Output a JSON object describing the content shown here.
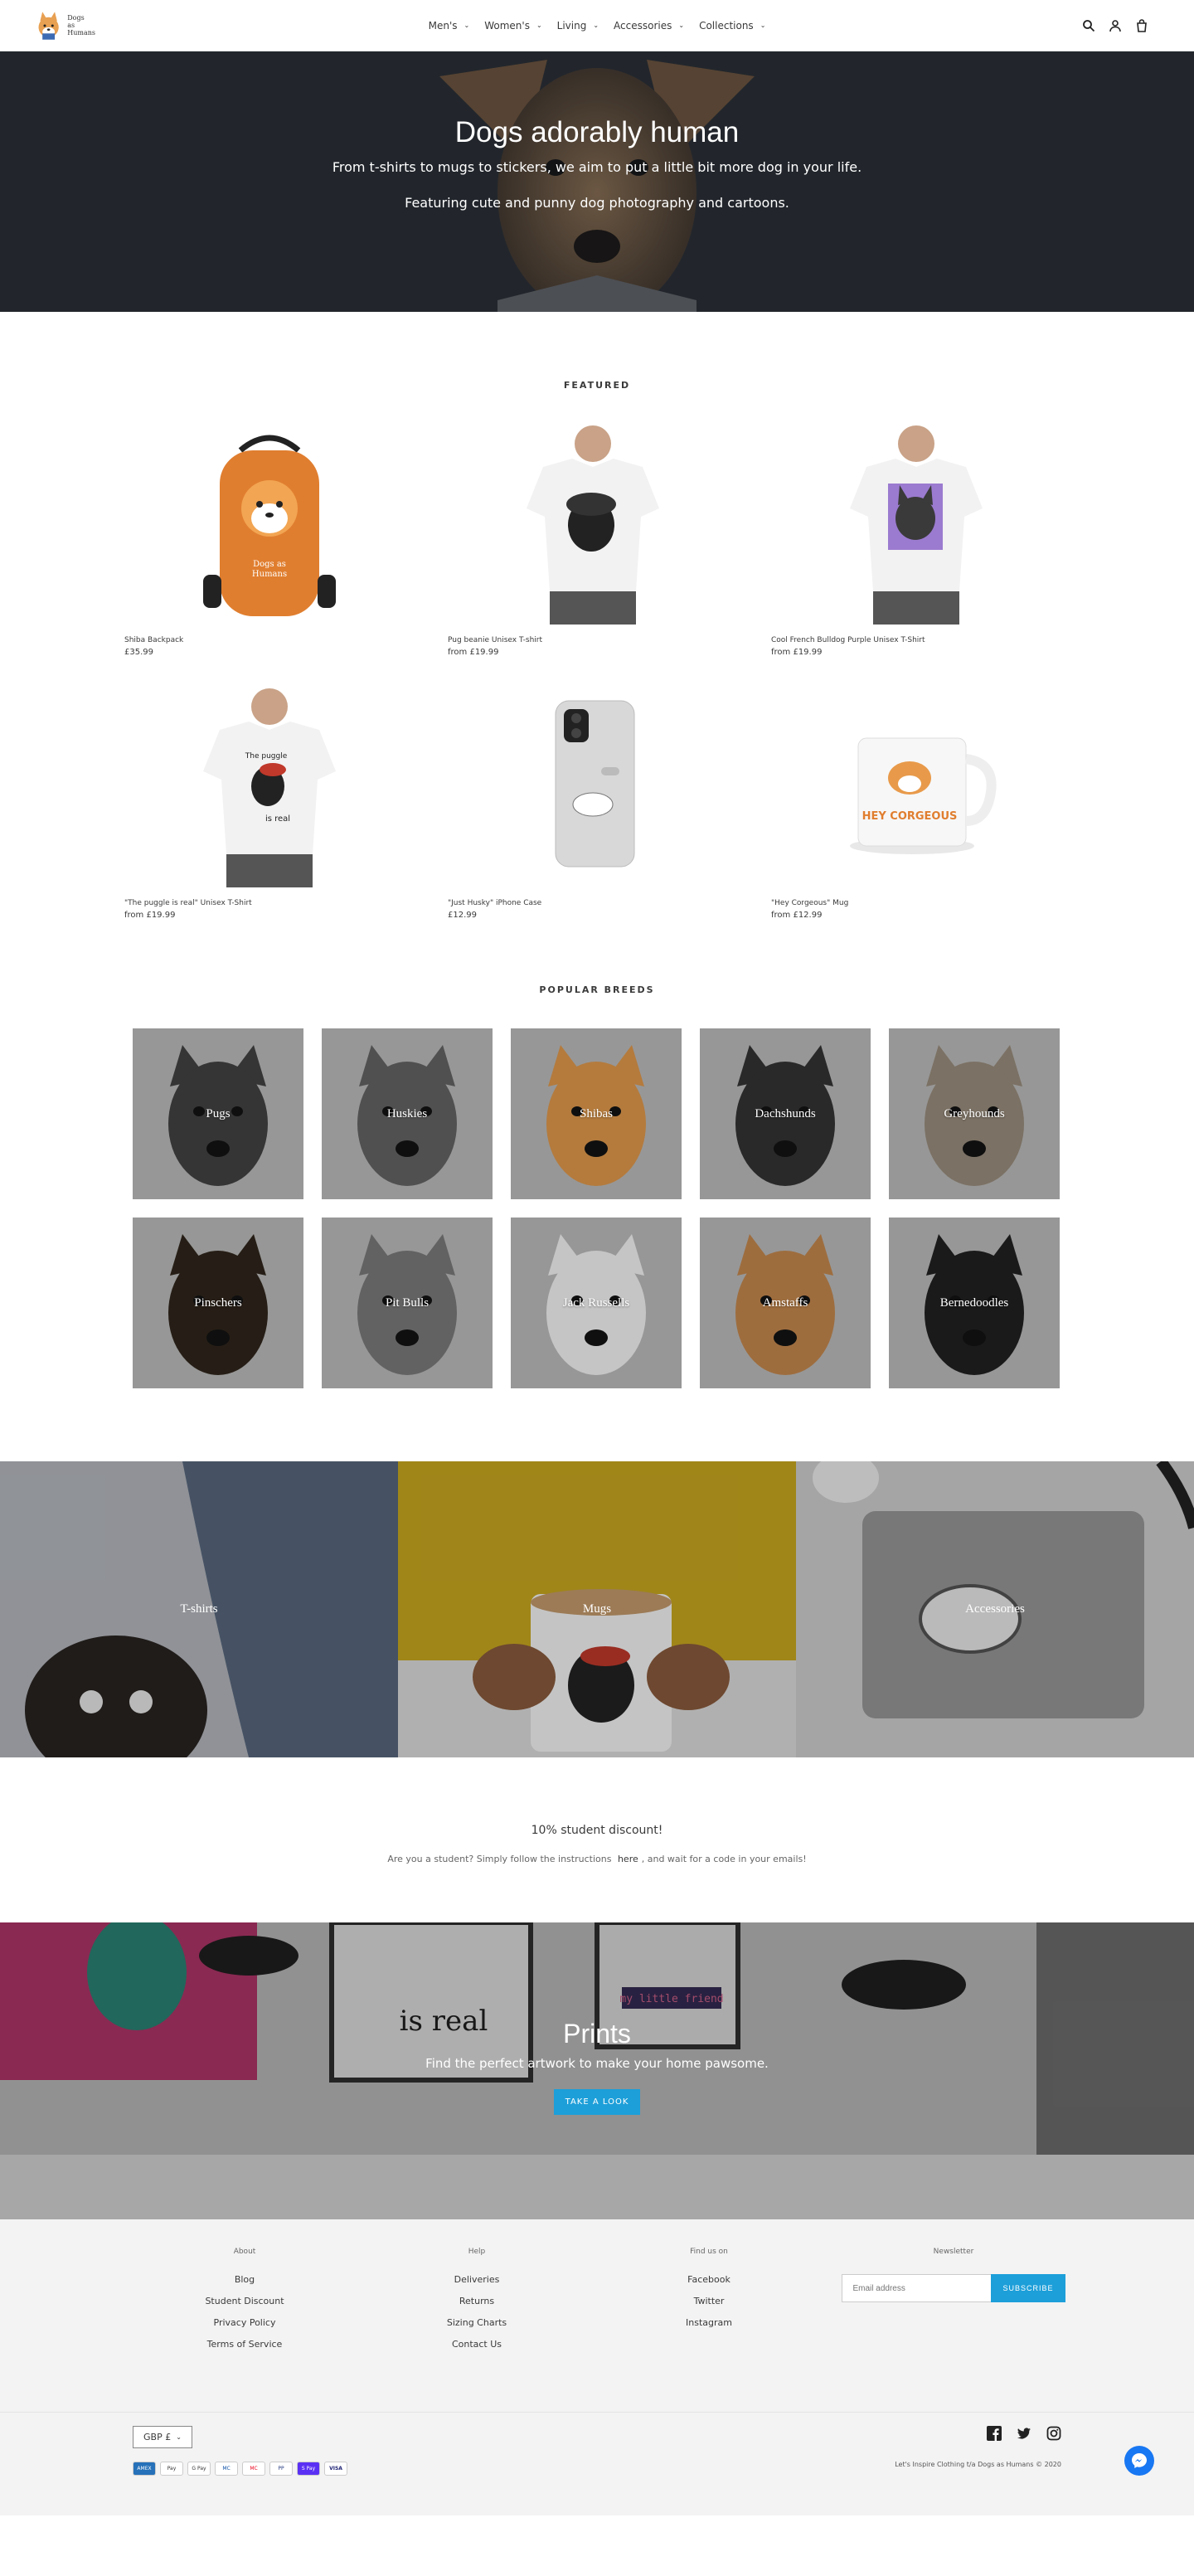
{
  "header": {
    "logo_lines": [
      "Dogs",
      "as",
      "Humans"
    ],
    "nav": [
      {
        "label": "Men's"
      },
      {
        "label": "Women's"
      },
      {
        "label": "Living"
      },
      {
        "label": "Accessories"
      },
      {
        "label": "Collections"
      }
    ]
  },
  "hero": {
    "title": "Dogs adorably human",
    "line1": "From t-shirts to mugs to stickers, we aim to put a little bit more dog in your life.",
    "line2": "Featuring cute and punny dog photography and cartoons."
  },
  "featured": {
    "title": "FEATURED",
    "products": [
      {
        "title": "Shiba Backpack",
        "price": "£35.99"
      },
      {
        "title": "Pug beanie Unisex T-shirt",
        "price": "from £19.99"
      },
      {
        "title": "Cool French Bulldog Purple Unisex T-Shirt",
        "price": "from £19.99"
      },
      {
        "title": "\"The puggle is real\" Unisex T-Shirt",
        "price": "from £19.99"
      },
      {
        "title": "\"Just Husky\" iPhone Case",
        "price": "£12.99"
      },
      {
        "title": "\"Hey Corgeous\" Mug",
        "price": "from £12.99"
      }
    ]
  },
  "breeds": {
    "title": "POPULAR BREEDS",
    "items": [
      {
        "name": "Pugs",
        "color": "#3b3b3b"
      },
      {
        "name": "Huskies",
        "color": "#5a5a5a"
      },
      {
        "name": "Shibas",
        "color": "#c98a45"
      },
      {
        "name": "Dachshunds",
        "color": "#2e2e2e"
      },
      {
        "name": "Greyhounds",
        "color": "#8a7e70"
      },
      {
        "name": "Pinschers",
        "color": "#2b2219"
      },
      {
        "name": "Pit Bulls",
        "color": "#6e6e6e"
      },
      {
        "name": "Jack Russells",
        "color": "#dcdcdc"
      },
      {
        "name": "Amstaffs",
        "color": "#b07a46"
      },
      {
        "name": "Bernedoodles",
        "color": "#1e1e1e"
      }
    ]
  },
  "collections": [
    {
      "name": "T-shirts"
    },
    {
      "name": "Mugs"
    },
    {
      "name": "Accessories"
    }
  ],
  "discount": {
    "title": "10% student discount!",
    "text_before": "Are you a student? Simply follow the instructions",
    "link": "here",
    "text_after": ", and wait for a code in your emails!"
  },
  "prints": {
    "title": "Prints",
    "subtitle": "Find the perfect artwork to make your home pawsome.",
    "button": "TAKE A LOOK"
  },
  "footer": {
    "about": {
      "heading": "About",
      "links": [
        "Blog",
        "Student Discount",
        "Privacy Policy",
        "Terms of Service"
      ]
    },
    "help": {
      "heading": "Help",
      "links": [
        "Deliveries",
        "Returns",
        "Sizing Charts",
        "Contact Us"
      ]
    },
    "findus": {
      "heading": "Find us on",
      "links": [
        "Facebook",
        "Twitter",
        "Instagram"
      ]
    },
    "newsletter": {
      "heading": "Newsletter",
      "placeholder": "Email address",
      "button": "SUBSCRIBE"
    },
    "currency": "GBP £",
    "payments": [
      "AMEX",
      "Pay",
      "G Pay",
      "MC",
      "MC",
      "PP",
      "S Pay",
      "VISA"
    ],
    "copyright": "Let's Inspire Clothing t/a Dogs as Humans © 2020"
  },
  "colors": {
    "accent": "#1d9fd9",
    "hero_bg": "#2a2e35",
    "footer_bg": "#f3f3f3"
  }
}
